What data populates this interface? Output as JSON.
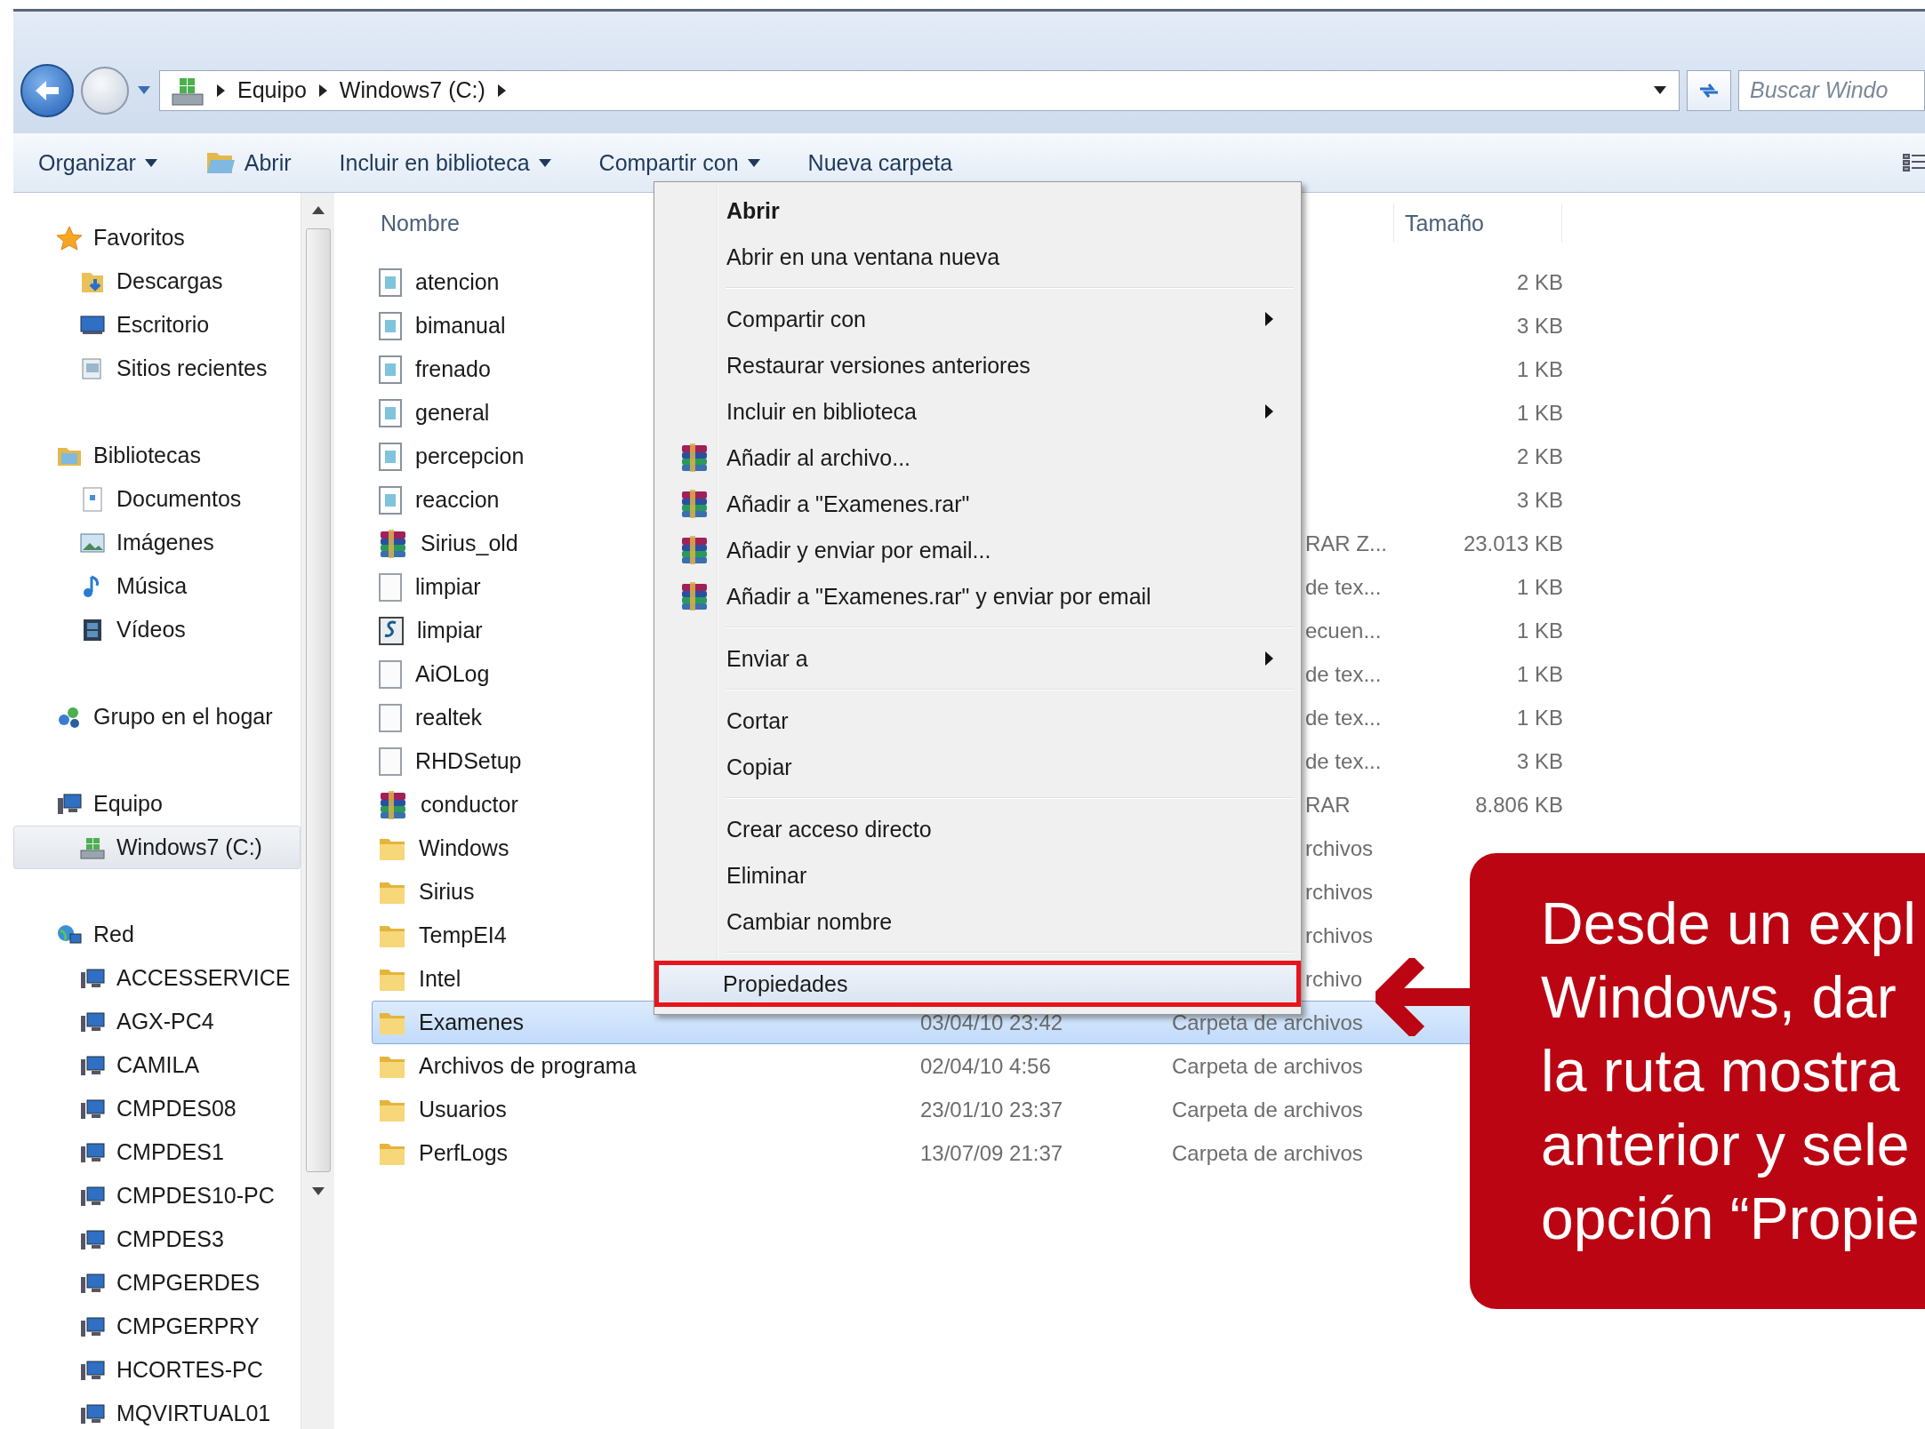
{
  "nav": {
    "breadcrumb": [
      "Equipo",
      "Windows7 (C:)"
    ],
    "search": {
      "placeholder": "Buscar Windo"
    }
  },
  "toolbar": [
    {
      "label": "Organizar",
      "kind": "menu"
    },
    {
      "label": "Abrir",
      "kind": "open"
    },
    {
      "label": "Incluir en biblioteca",
      "kind": "menu"
    },
    {
      "label": "Compartir con",
      "kind": "menu"
    },
    {
      "label": "Nueva carpeta",
      "kind": "plain"
    }
  ],
  "sidebar": [
    {
      "label": "Favoritos",
      "kind": "star",
      "selected": false,
      "children": [
        {
          "label": "Descargas",
          "kind": "downloads",
          "selected": false
        },
        {
          "label": "Escritorio",
          "kind": "desktop",
          "selected": false
        },
        {
          "label": "Sitios recientes",
          "kind": "recent",
          "selected": false
        }
      ]
    },
    {
      "label": "Bibliotecas",
      "kind": "library",
      "selected": false,
      "children": [
        {
          "label": "Documentos",
          "kind": "document",
          "selected": false
        },
        {
          "label": "Imágenes",
          "kind": "image",
          "selected": false
        },
        {
          "label": "Música",
          "kind": "music",
          "selected": false
        },
        {
          "label": "Vídeos",
          "kind": "video",
          "selected": false
        }
      ]
    },
    {
      "label": "Grupo en el hogar",
      "kind": "homegroup",
      "selected": false
    },
    {
      "label": "Equipo",
      "kind": "computer",
      "selected": false,
      "children": [
        {
          "label": "Windows7 (C:)",
          "kind": "drive",
          "selected": true
        }
      ]
    },
    {
      "label": "Red",
      "kind": "network",
      "selected": false,
      "children": [
        {
          "label": "ACCESSERVICE",
          "kind": "pc",
          "selected": false
        },
        {
          "label": "AGX-PC4",
          "kind": "pc",
          "selected": false
        },
        {
          "label": "CAMILA",
          "kind": "pc",
          "selected": false
        },
        {
          "label": "CMPDES08",
          "kind": "pc",
          "selected": false
        },
        {
          "label": "CMPDES1",
          "kind": "pc",
          "selected": false
        },
        {
          "label": "CMPDES10-PC",
          "kind": "pc",
          "selected": false
        },
        {
          "label": "CMPDES3",
          "kind": "pc",
          "selected": false
        },
        {
          "label": "CMPGERDES",
          "kind": "pc",
          "selected": false
        },
        {
          "label": "CMPGERPRY",
          "kind": "pc",
          "selected": false
        },
        {
          "label": "HCORTES-PC",
          "kind": "pc",
          "selected": false
        },
        {
          "label": "MQVIRTUAL01",
          "kind": "pc",
          "selected": false
        }
      ]
    }
  ],
  "files": {
    "columns": {
      "name": "Nombre",
      "size": "Tamaño"
    },
    "rows": [
      {
        "name": "atencion",
        "kind": "doc",
        "size": "2 KB",
        "selected": false
      },
      {
        "name": "bimanual",
        "kind": "doc",
        "size": "3 KB",
        "selected": false
      },
      {
        "name": "frenado",
        "kind": "doc",
        "size": "1 KB",
        "selected": false
      },
      {
        "name": "general",
        "kind": "doc",
        "size": "1 KB",
        "selected": false
      },
      {
        "name": "percepcion",
        "kind": "doc",
        "size": "2 KB",
        "selected": false
      },
      {
        "name": "reaccion",
        "kind": "doc",
        "size": "3 KB",
        "selected": false
      },
      {
        "name": "Sirius_old",
        "kind": "rar",
        "type": "RAR Z...",
        "size": "23.013 KB",
        "selected": false
      },
      {
        "name": "limpiar",
        "kind": "blank",
        "type": "de tex...",
        "size": "1 KB",
        "selected": false
      },
      {
        "name": "limpiar",
        "kind": "script",
        "type": "ecuen...",
        "size": "1 KB",
        "selected": false
      },
      {
        "name": "AiOLog",
        "kind": "blank",
        "type": "de tex...",
        "size": "1 KB",
        "selected": false
      },
      {
        "name": "realtek",
        "kind": "blank",
        "type": "de tex...",
        "size": "1 KB",
        "selected": false
      },
      {
        "name": "RHDSetup",
        "kind": "blank",
        "type": "de tex...",
        "size": "3 KB",
        "selected": false
      },
      {
        "name": "conductor",
        "kind": "rar",
        "type": "RAR",
        "size": "8.806 KB",
        "selected": false
      },
      {
        "name": "Windows",
        "kind": "folder",
        "type": "rchivos",
        "selected": false
      },
      {
        "name": "Sirius",
        "kind": "folder",
        "type": "rchivos",
        "selected": false
      },
      {
        "name": "TempEI4",
        "kind": "folder",
        "type": "rchivos",
        "selected": false
      },
      {
        "name": "Intel",
        "kind": "folder",
        "type": "rchivo",
        "selected": false
      },
      {
        "name": "Examenes",
        "kind": "folder",
        "date": "03/04/10 23:42",
        "type": "Carpeta de archivos",
        "selected": true
      },
      {
        "name": "Archivos de programa",
        "kind": "folder",
        "date": "02/04/10 4:56",
        "type": "Carpeta de archivos",
        "selected": false
      },
      {
        "name": "Usuarios",
        "kind": "folder",
        "date": "23/01/10 23:37",
        "type": "Carpeta de archivos",
        "selected": false
      },
      {
        "name": "PerfLogs",
        "kind": "folder",
        "date": "13/07/09 21:37",
        "type": "Carpeta de archivos",
        "selected": false
      }
    ]
  },
  "context_menu": [
    [
      {
        "label": "Abrir",
        "default": true,
        "submenu": false,
        "kind": "plain",
        "selected": false
      },
      {
        "label": "Abrir en una ventana nueva",
        "default": false,
        "submenu": false,
        "kind": "plain",
        "selected": false
      }
    ],
    [
      {
        "label": "Compartir con",
        "default": false,
        "submenu": true,
        "kind": "plain",
        "selected": false
      },
      {
        "label": "Restaurar versiones anteriores",
        "default": false,
        "submenu": false,
        "kind": "plain",
        "selected": false
      },
      {
        "label": "Incluir en biblioteca",
        "default": false,
        "submenu": true,
        "kind": "plain",
        "selected": false
      },
      {
        "label": "Añadir al archivo...",
        "default": false,
        "submenu": false,
        "kind": "rar",
        "selected": false
      },
      {
        "label": "Añadir a \"Examenes.rar\"",
        "default": false,
        "submenu": false,
        "kind": "rar",
        "selected": false
      },
      {
        "label": "Añadir y enviar por email...",
        "default": false,
        "submenu": false,
        "kind": "rar",
        "selected": false
      },
      {
        "label": "Añadir a \"Examenes.rar\" y enviar por email",
        "default": false,
        "submenu": false,
        "kind": "rar",
        "selected": false
      }
    ],
    [
      {
        "label": "Enviar a",
        "default": false,
        "submenu": true,
        "kind": "plain",
        "selected": false
      }
    ],
    [
      {
        "label": "Cortar",
        "default": false,
        "submenu": false,
        "kind": "plain",
        "selected": false
      },
      {
        "label": "Copiar",
        "default": false,
        "submenu": false,
        "kind": "plain",
        "selected": false
      }
    ],
    [
      {
        "label": "Crear acceso directo",
        "default": false,
        "submenu": false,
        "kind": "plain",
        "selected": false
      },
      {
        "label": "Eliminar",
        "default": false,
        "submenu": false,
        "kind": "plain",
        "selected": false
      },
      {
        "label": "Cambiar nombre",
        "default": false,
        "submenu": false,
        "kind": "plain",
        "selected": false
      }
    ],
    [
      {
        "label": "Propiedades",
        "default": false,
        "submenu": false,
        "kind": "plain",
        "selected": true
      }
    ]
  ],
  "callout": {
    "lines": [
      "Desde un expl",
      "Windows, dar",
      "la ruta mostra",
      "anterior y sele",
      "opción “Propie"
    ]
  }
}
